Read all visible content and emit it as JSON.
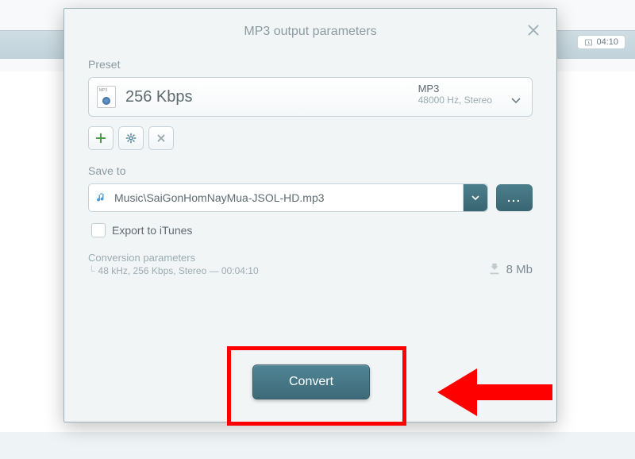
{
  "dialog": {
    "title": "MP3 output parameters",
    "preset_label": "Preset",
    "preset_value": "256 Kbps",
    "preset_format": "MP3",
    "preset_sub": "48000 Hz,  Stereo",
    "save_label": "Save to",
    "save_path": "Music\\SaiGonHomNayMua-JSOL-HD.mp3",
    "browse_dots": "...",
    "export_label": "Export to iTunes",
    "params_header": "Conversion parameters",
    "params_detail": "48 kHz, 256 Kbps, Stereo — 00:04:10",
    "size": "8 Mb",
    "convert": "Convert"
  },
  "background": {
    "time": "04:10"
  }
}
